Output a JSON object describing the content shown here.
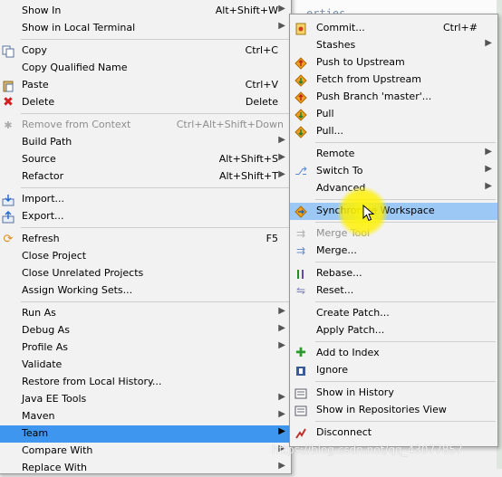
{
  "background": {
    "editor_text": "erties"
  },
  "main_menu": {
    "items": [
      {
        "label": "Show In",
        "accel": "Alt+Shift+W",
        "submenu": true,
        "icon": ""
      },
      {
        "label": "Show in Local Terminal",
        "accel": "",
        "submenu": true,
        "icon": ""
      },
      {
        "label": "Copy",
        "accel": "Ctrl+C",
        "submenu": false,
        "icon": "copy-icon"
      },
      {
        "label": "Copy Qualified Name",
        "accel": "",
        "submenu": false,
        "icon": ""
      },
      {
        "label": "Paste",
        "accel": "Ctrl+V",
        "submenu": false,
        "icon": "paste-icon"
      },
      {
        "label": "Delete",
        "accel": "Delete",
        "submenu": false,
        "icon": "delete-icon"
      },
      {
        "label": "Remove from Context",
        "accel": "Ctrl+Alt+Shift+Down",
        "submenu": false,
        "icon": "remove-context-icon",
        "disabled": true
      },
      {
        "label": "Build Path",
        "accel": "",
        "submenu": true,
        "icon": ""
      },
      {
        "label": "Source",
        "accel": "Alt+Shift+S",
        "submenu": true,
        "icon": ""
      },
      {
        "label": "Refactor",
        "accel": "Alt+Shift+T",
        "submenu": true,
        "icon": ""
      },
      {
        "label": "Import...",
        "accel": "",
        "submenu": false,
        "icon": "import-icon"
      },
      {
        "label": "Export...",
        "accel": "",
        "submenu": false,
        "icon": "export-icon"
      },
      {
        "label": "Refresh",
        "accel": "F5",
        "submenu": false,
        "icon": "refresh-icon"
      },
      {
        "label": "Close Project",
        "accel": "",
        "submenu": false,
        "icon": ""
      },
      {
        "label": "Close Unrelated Projects",
        "accel": "",
        "submenu": false,
        "icon": ""
      },
      {
        "label": "Assign Working Sets...",
        "accel": "",
        "submenu": false,
        "icon": ""
      },
      {
        "label": "Run As",
        "accel": "",
        "submenu": true,
        "icon": ""
      },
      {
        "label": "Debug As",
        "accel": "",
        "submenu": true,
        "icon": ""
      },
      {
        "label": "Profile As",
        "accel": "",
        "submenu": true,
        "icon": ""
      },
      {
        "label": "Validate",
        "accel": "",
        "submenu": false,
        "icon": ""
      },
      {
        "label": "Restore from Local History...",
        "accel": "",
        "submenu": false,
        "icon": ""
      },
      {
        "label": "Java EE Tools",
        "accel": "",
        "submenu": true,
        "icon": ""
      },
      {
        "label": "Maven",
        "accel": "",
        "submenu": true,
        "icon": ""
      },
      {
        "label": "Team",
        "accel": "",
        "submenu": true,
        "icon": "",
        "highlighted": true
      },
      {
        "label": "Compare With",
        "accel": "",
        "submenu": true,
        "icon": ""
      },
      {
        "label": "Replace With",
        "accel": "",
        "submenu": true,
        "icon": ""
      }
    ]
  },
  "team_menu": {
    "items": [
      {
        "label": "Commit...",
        "accel": "Ctrl+#",
        "submenu": false,
        "icon": "commit-icon"
      },
      {
        "label": "Stashes",
        "accel": "",
        "submenu": true,
        "icon": ""
      },
      {
        "label": "Push to Upstream",
        "accel": "",
        "submenu": false,
        "icon": "push-icon"
      },
      {
        "label": "Fetch from Upstream",
        "accel": "",
        "submenu": false,
        "icon": "fetch-icon"
      },
      {
        "label": "Push Branch 'master'...",
        "accel": "",
        "submenu": false,
        "icon": "push-branch-icon"
      },
      {
        "label": "Pull",
        "accel": "",
        "submenu": false,
        "icon": "pull-icon"
      },
      {
        "label": "Pull...",
        "accel": "",
        "submenu": false,
        "icon": "pull-dialog-icon"
      },
      {
        "label": "Remote",
        "accel": "",
        "submenu": true,
        "icon": ""
      },
      {
        "label": "Switch To",
        "accel": "",
        "submenu": true,
        "icon": "switch-branch-icon"
      },
      {
        "label": "Advanced",
        "accel": "",
        "submenu": true,
        "icon": ""
      },
      {
        "label": "Synchronize Workspace",
        "accel": "",
        "submenu": false,
        "icon": "synchronize-icon",
        "hover": true
      },
      {
        "label": "Merge Tool",
        "accel": "",
        "submenu": false,
        "icon": "merge-tool-icon",
        "disabled": true
      },
      {
        "label": "Merge...",
        "accel": "",
        "submenu": false,
        "icon": "merge-icon"
      },
      {
        "label": "Rebase...",
        "accel": "",
        "submenu": false,
        "icon": "rebase-icon"
      },
      {
        "label": "Reset...",
        "accel": "",
        "submenu": false,
        "icon": "reset-icon"
      },
      {
        "label": "Create Patch...",
        "accel": "",
        "submenu": false,
        "icon": ""
      },
      {
        "label": "Apply Patch...",
        "accel": "",
        "submenu": false,
        "icon": ""
      },
      {
        "label": "Add to Index",
        "accel": "",
        "submenu": false,
        "icon": "add-to-index-icon"
      },
      {
        "label": "Ignore",
        "accel": "",
        "submenu": false,
        "icon": "ignore-icon"
      },
      {
        "label": "Show in History",
        "accel": "",
        "submenu": false,
        "icon": "history-icon"
      },
      {
        "label": "Show in Repositories View",
        "accel": "",
        "submenu": false,
        "icon": "repositories-icon"
      },
      {
        "label": "Disconnect",
        "accel": "",
        "submenu": false,
        "icon": "disconnect-icon"
      }
    ]
  },
  "watermark": "https://blog.csdn.net/qq_43077857",
  "colors": {
    "highlight": "#3f96ee",
    "hover": "#9cc8f5",
    "menu_bg": "#f2f2f2"
  }
}
